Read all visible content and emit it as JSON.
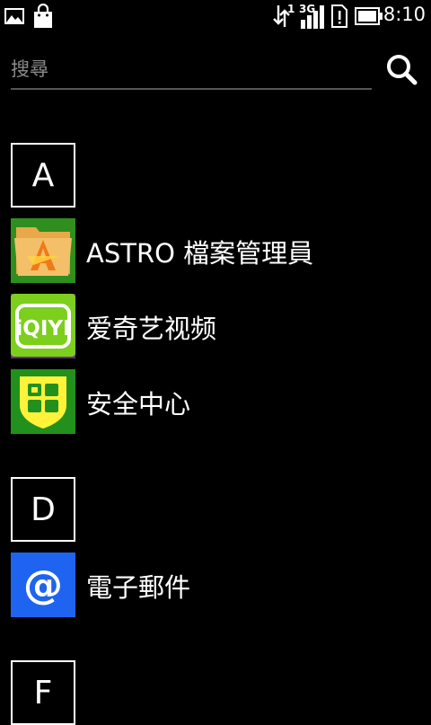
{
  "status_bar": {
    "left_icons": [
      "image-icon",
      "shopping-bag-icon"
    ],
    "right_icons": [
      "data-transfer-icon",
      "signal-3g-icon",
      "sim-alert-icon",
      "battery-icon"
    ],
    "data_badge": "1",
    "network_type": "3G",
    "time": "8:10"
  },
  "search": {
    "placeholder": "搜尋",
    "value": "",
    "icon": "search-icon"
  },
  "sections": [
    {
      "letter": "A",
      "apps": [
        {
          "label": "ASTRO 檔案管理員",
          "icon": "astro-folder-icon",
          "color": "#2f8f1e"
        },
        {
          "label": "爱奇艺视频",
          "icon": "iqiyi-icon",
          "color": "#7ccf1c"
        },
        {
          "label": "安全中心",
          "icon": "security-shield-icon",
          "color": "#22901c"
        }
      ]
    },
    {
      "letter": "D",
      "apps": [
        {
          "label": "電子郵件",
          "icon": "at-email-icon",
          "color": "#1e64f0"
        }
      ]
    },
    {
      "letter": "F",
      "apps": []
    }
  ]
}
